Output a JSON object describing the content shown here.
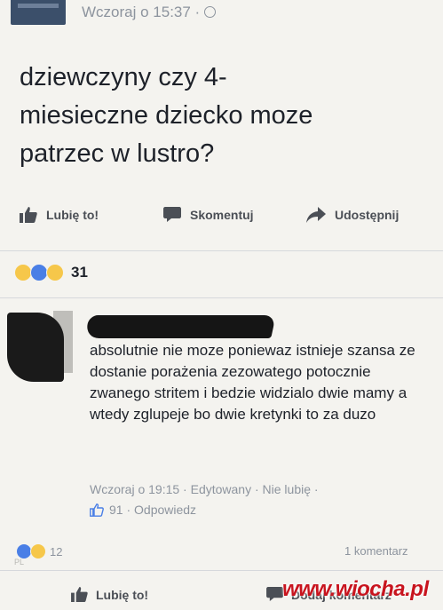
{
  "header": {
    "timestamp": "Wczoraj o 15:37 · ",
    "globe_icon": "globe-icon"
  },
  "post": {
    "text": "dziewczyny czy 4-\nmiesieczne dziecko moze\npatrzec w lustro?"
  },
  "actions": {
    "like_label": "Lubię to!",
    "comment_label": "Skomentuj",
    "share_label": "Udostępnij"
  },
  "reactions": {
    "count": "31",
    "icons": [
      "haha-reaction-icon",
      "like-reaction-icon",
      "sad-reaction-icon"
    ]
  },
  "comment": {
    "text": "absolutnie nie moze poniewaz istnieje szansa ze dostanie porażenia zezowatego potocznie zwanego stritem i bedzie widzialo dwie mamy a wtedy zglupeje bo dwie kretynki to za duzo",
    "meta": "Wczoraj o 19:15 · Edytowany · Nie lubię ·",
    "likes": "91",
    "reply_label": "· Odpowiedz"
  },
  "footer": {
    "reaction_count": "12",
    "comments_count": "1 komentarz",
    "like_label": "Lubię to!",
    "add_comment_label": "Dodaj komentarz"
  },
  "watermark": {
    "text": "www.wiocha.pl",
    "corner_mark": "PL"
  },
  "colors": {
    "text": "#1d2129",
    "muted": "#8d949e",
    "action": "#4b4f56",
    "like_blue": "#4a7fe6",
    "watermark_red": "#c8141e"
  }
}
